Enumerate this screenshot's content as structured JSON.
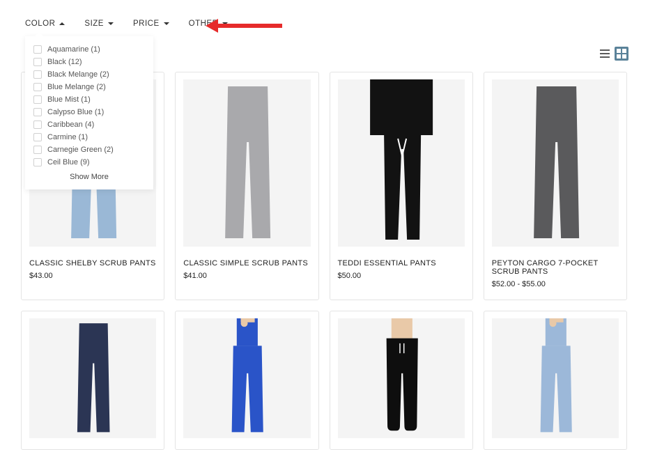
{
  "filters": {
    "color": "COLOR",
    "size": "SIZE",
    "price": "PRICE",
    "other": "OTHER"
  },
  "color_dropdown": {
    "options": [
      {
        "label": "Aquamarine (1)"
      },
      {
        "label": "Black (12)"
      },
      {
        "label": "Black Melange (2)"
      },
      {
        "label": "Blue Melange (2)"
      },
      {
        "label": "Blue Mist (1)"
      },
      {
        "label": "Calypso Blue (1)"
      },
      {
        "label": "Caribbean (4)"
      },
      {
        "label": "Carmine (1)"
      },
      {
        "label": "Carnegie Green (2)"
      },
      {
        "label": "Ceil Blue (9)"
      }
    ],
    "show_more": "Show More"
  },
  "products": [
    {
      "name": "CLASSIC SHELBY SCRUB PANTS",
      "price": "$43.00",
      "img": "ceil-blue"
    },
    {
      "name": "CLASSIC SIMPLE SCRUB PANTS",
      "price": "$41.00",
      "img": "gray"
    },
    {
      "name": "TEDDI ESSENTIAL PANTS",
      "price": "$50.00",
      "img": "black-tie"
    },
    {
      "name": "PEYTON CARGO 7-POCKET SCRUB PANTS",
      "price": "$52.00 - $55.00",
      "img": "charcoal"
    },
    {
      "name": "",
      "price": "",
      "img": "navy"
    },
    {
      "name": "",
      "price": "",
      "img": "royal"
    },
    {
      "name": "",
      "price": "",
      "img": "black-jogger"
    },
    {
      "name": "",
      "price": "",
      "img": "ceil-full"
    }
  ],
  "colors": {
    "ceil-blue": "#9ab8d6",
    "gray": "#a9a9ac",
    "black-tie": "#121212",
    "charcoal": "#5a5a5c",
    "navy": "#2b3554",
    "royal": "#2a54c8",
    "black-jogger": "#0e0e0e",
    "ceil-full": "#9cb8d9"
  }
}
